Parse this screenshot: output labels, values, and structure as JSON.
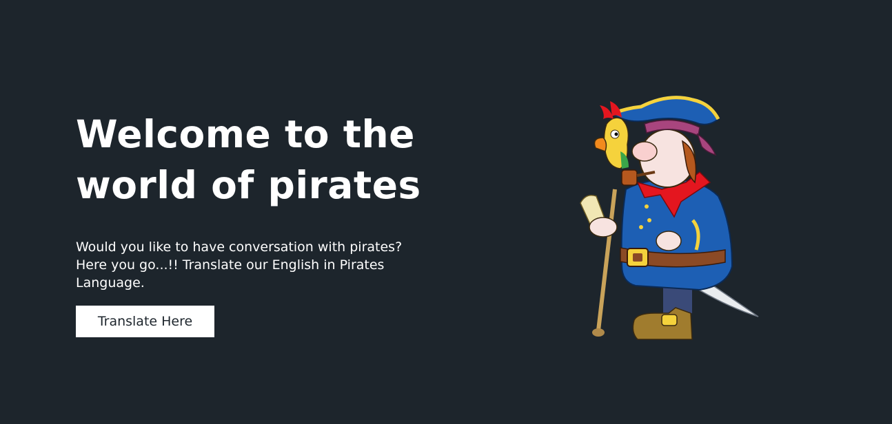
{
  "hero": {
    "title_line1": "Welcome to the",
    "title_line2": "world of pirates",
    "description": "Would you like to have conversation with pirates? Here you go...!! Translate our English in Pirates Language.",
    "button_label": "Translate Here"
  },
  "illustration": {
    "icon": "pirate-with-parrot-illustration"
  },
  "colors": {
    "background": "#1d252c",
    "text": "#ffffff",
    "button_bg": "#ffffff",
    "button_text": "#1d252c"
  }
}
